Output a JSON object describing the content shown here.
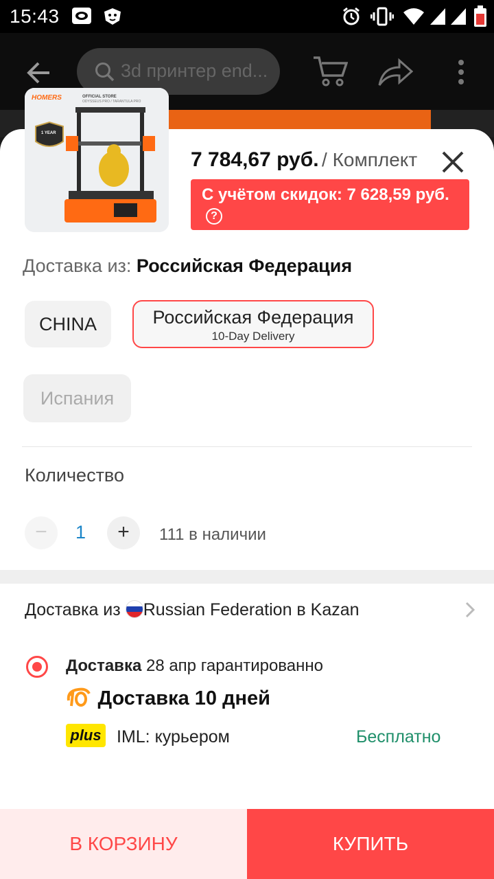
{
  "status_bar": {
    "time": "15:43"
  },
  "toolbar": {
    "search_placeholder": "3d принтер end..."
  },
  "product": {
    "thumb_brand": "HOMERS",
    "thumb_store": "OFFICIAL STORE",
    "thumb_models": "ODYSSEUS PRO / TARANTULA PRO",
    "thumb_warranty": "1 YEAR",
    "price": "7 784,67 руб.",
    "unit": "/ Комплект",
    "discount_label": "С учётом скидок: 7 628,59 руб."
  },
  "shipping": {
    "from_label": "Доставка из: ",
    "from_value": "Российская Федерация",
    "options": [
      {
        "name": "CHINA",
        "sub": ""
      },
      {
        "name": "Российская Федерация",
        "sub": "10-Day Delivery"
      },
      {
        "name": "Испания",
        "sub": ""
      }
    ]
  },
  "quantity": {
    "label": "Количество",
    "value": "1",
    "stock": "111 в наличии",
    "minus": "−",
    "plus": "+"
  },
  "delivery": {
    "header_prefix": "Доставка из ",
    "header_suffix": "Russian Federation в Kazan",
    "method_bold": "Доставка",
    "method_rest": " 28 апр гарантированно",
    "fast_label": "Доставка 10 дней",
    "plus_badge": "plus",
    "courier": "IML: курьером",
    "price": "Бесплатно"
  },
  "actions": {
    "cart": "В КОРЗИНУ",
    "buy": "КУПИТЬ"
  },
  "colors": {
    "accent": "#ff4747",
    "free": "#1f8f6a",
    "qty": "#1a85c8",
    "plus_badge": "#ffe600"
  }
}
